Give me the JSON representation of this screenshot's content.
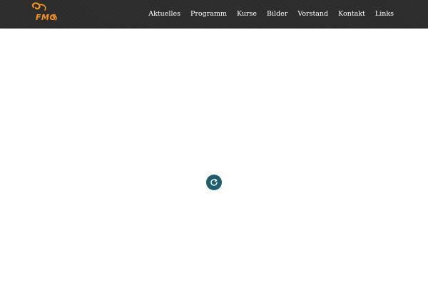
{
  "brand": {
    "logo_text": "FMG",
    "color": "#f7941d"
  },
  "nav": {
    "items": [
      {
        "label": "Aktuelles"
      },
      {
        "label": "Programm"
      },
      {
        "label": "Kurse"
      },
      {
        "label": "Bilder"
      },
      {
        "label": "Vorstand"
      },
      {
        "label": "Kontakt"
      },
      {
        "label": "Links"
      }
    ]
  },
  "loader": {
    "icon": "refresh-icon",
    "color": "#1f5e6e"
  },
  "colors": {
    "navbar": "#2b2b2b",
    "nav_text": "#ffffff",
    "background": "#ffffff"
  }
}
